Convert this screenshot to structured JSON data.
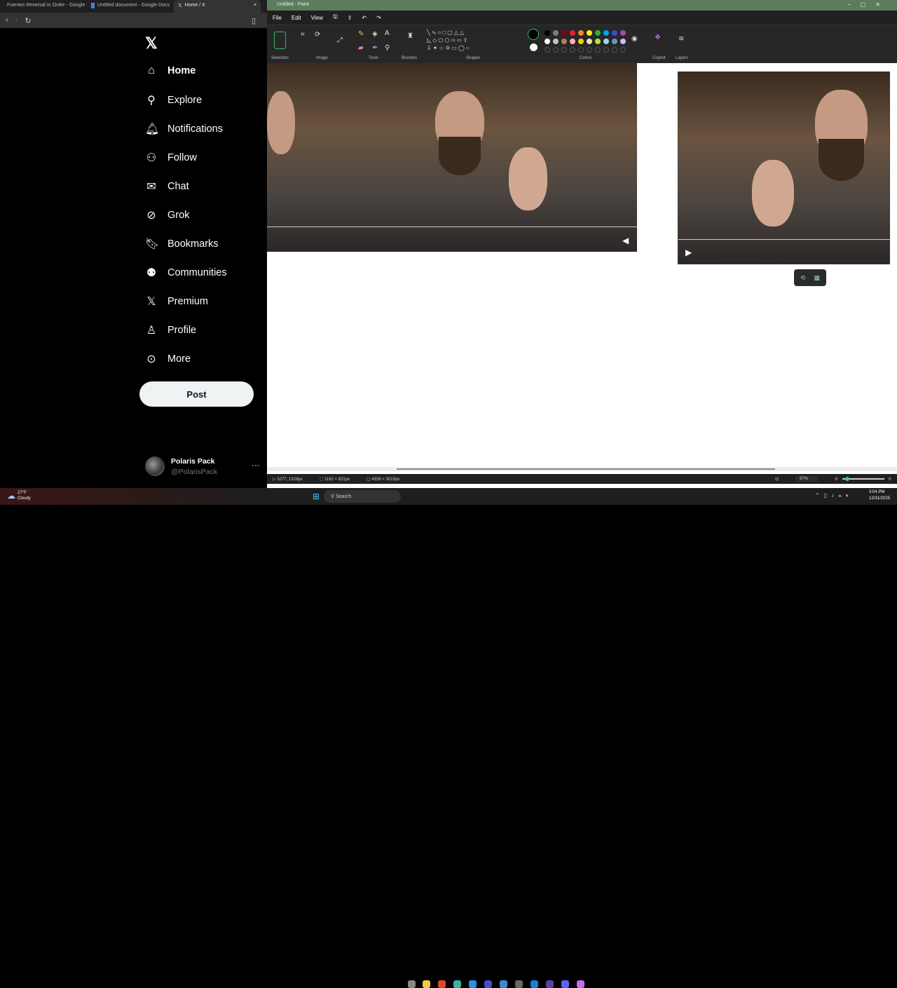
{
  "browser": {
    "tabs": [
      {
        "label": "Fuentes Reversal In Order - Google D"
      },
      {
        "label": "Untitled document - Google Docs"
      },
      {
        "label": "Home / X",
        "active": true
      }
    ]
  },
  "x": {
    "nav": [
      {
        "label": "Home",
        "icon": "home-icon"
      },
      {
        "label": "Explore",
        "icon": "search-icon"
      },
      {
        "label": "Notifications",
        "icon": "bell-icon"
      },
      {
        "label": "Follow",
        "icon": "follow-icon"
      },
      {
        "label": "Chat",
        "icon": "mail-icon"
      },
      {
        "label": "Grok",
        "icon": "grok-icon"
      },
      {
        "label": "Bookmarks",
        "icon": "bookmark-icon"
      },
      {
        "label": "Communities",
        "icon": "communities-icon"
      },
      {
        "label": "Premium",
        "icon": "x-icon"
      },
      {
        "label": "Profile",
        "icon": "person-icon"
      },
      {
        "label": "More",
        "icon": "more-icon"
      }
    ],
    "post_label": "Post",
    "user": {
      "name": "Polaris Pack",
      "handle": "@PolarisPack"
    }
  },
  "paint": {
    "title": "Untitled - Paint",
    "menu": [
      "File",
      "Edit",
      "View"
    ],
    "groups": [
      "Selection",
      "Image",
      "Tools",
      "Brushes",
      "Shapes",
      "Colors",
      "Copilot",
      "Layers"
    ],
    "colors": {
      "row1": [
        "#000000",
        "#7f7f7f",
        "#880015",
        "#ed1c24",
        "#ff7f27",
        "#fff200",
        "#22b14c",
        "#00a2e8",
        "#3f48cc",
        "#a349a4"
      ],
      "row2": [
        "#ffffff",
        "#c3c3c3",
        "#b97a57",
        "#ffaec9",
        "#ffc90e",
        "#efe4b0",
        "#b5e61d",
        "#99d9ea",
        "#7092be",
        "#c8bfe7"
      ]
    },
    "status": {
      "cursor": "3277, 1329px",
      "selection": "1162 × 821px",
      "canvas": "4336 × 3015px",
      "zoom": "87%"
    }
  },
  "taskbar": {
    "weather_temp": "27°F",
    "weather_desc": "Cloudy",
    "search": "Search",
    "time": "3:04 PM",
    "date": "12/31/2025"
  }
}
